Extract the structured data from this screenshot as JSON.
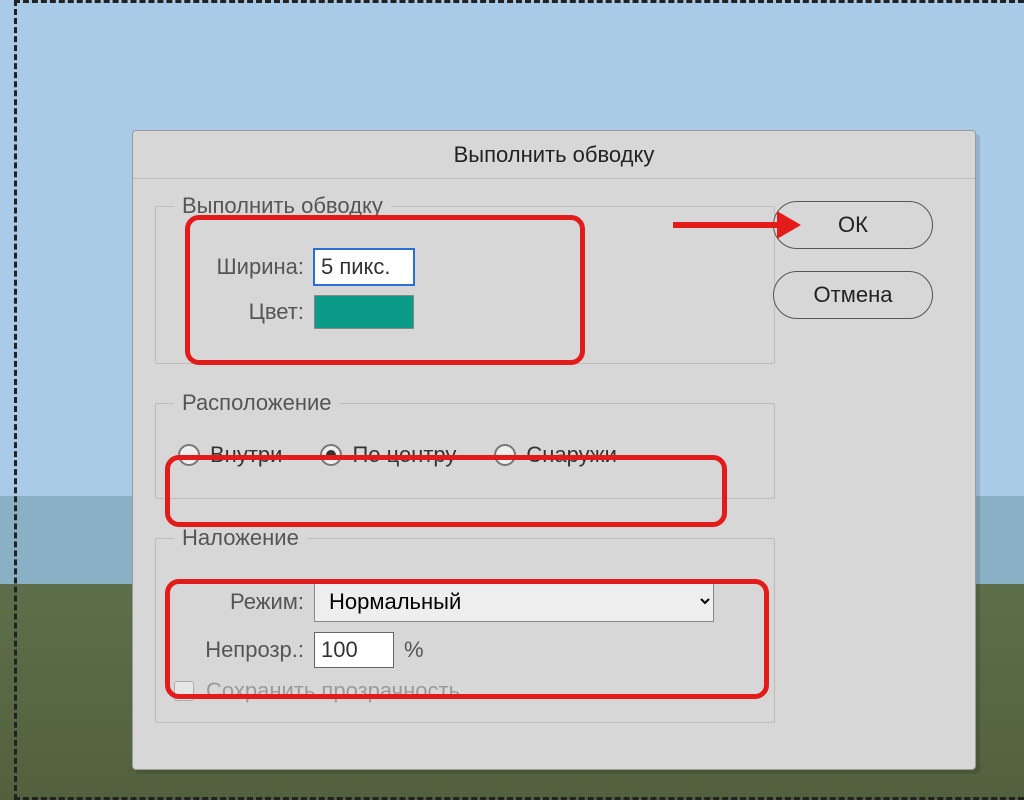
{
  "dialog": {
    "title": "Выполнить обводку",
    "stroke_group": {
      "legend": "Выполнить обводку",
      "width_label": "Ширина:",
      "width_value": "5 пикс.",
      "color_label": "Цвет:",
      "color_hex": "#0a9a87"
    },
    "position_group": {
      "legend": "Расположение",
      "options": {
        "inside": "Внутри",
        "center": "По центру",
        "outside": "Снаружи"
      },
      "selected": "center"
    },
    "blend_group": {
      "legend": "Наложение",
      "mode_label": "Режим:",
      "mode_value": "Нормальный",
      "opacity_label": "Непрозр.:",
      "opacity_value": "100",
      "opacity_suffix": "%",
      "preserve_label": "Сохранить прозрачность",
      "preserve_checked": false
    },
    "buttons": {
      "ok": "ОК",
      "cancel": "Отмена"
    }
  },
  "annotations": {
    "highlight_boxes": [
      "stroke-settings",
      "position-row",
      "blend-settings"
    ],
    "arrow_target": "ok-button"
  }
}
